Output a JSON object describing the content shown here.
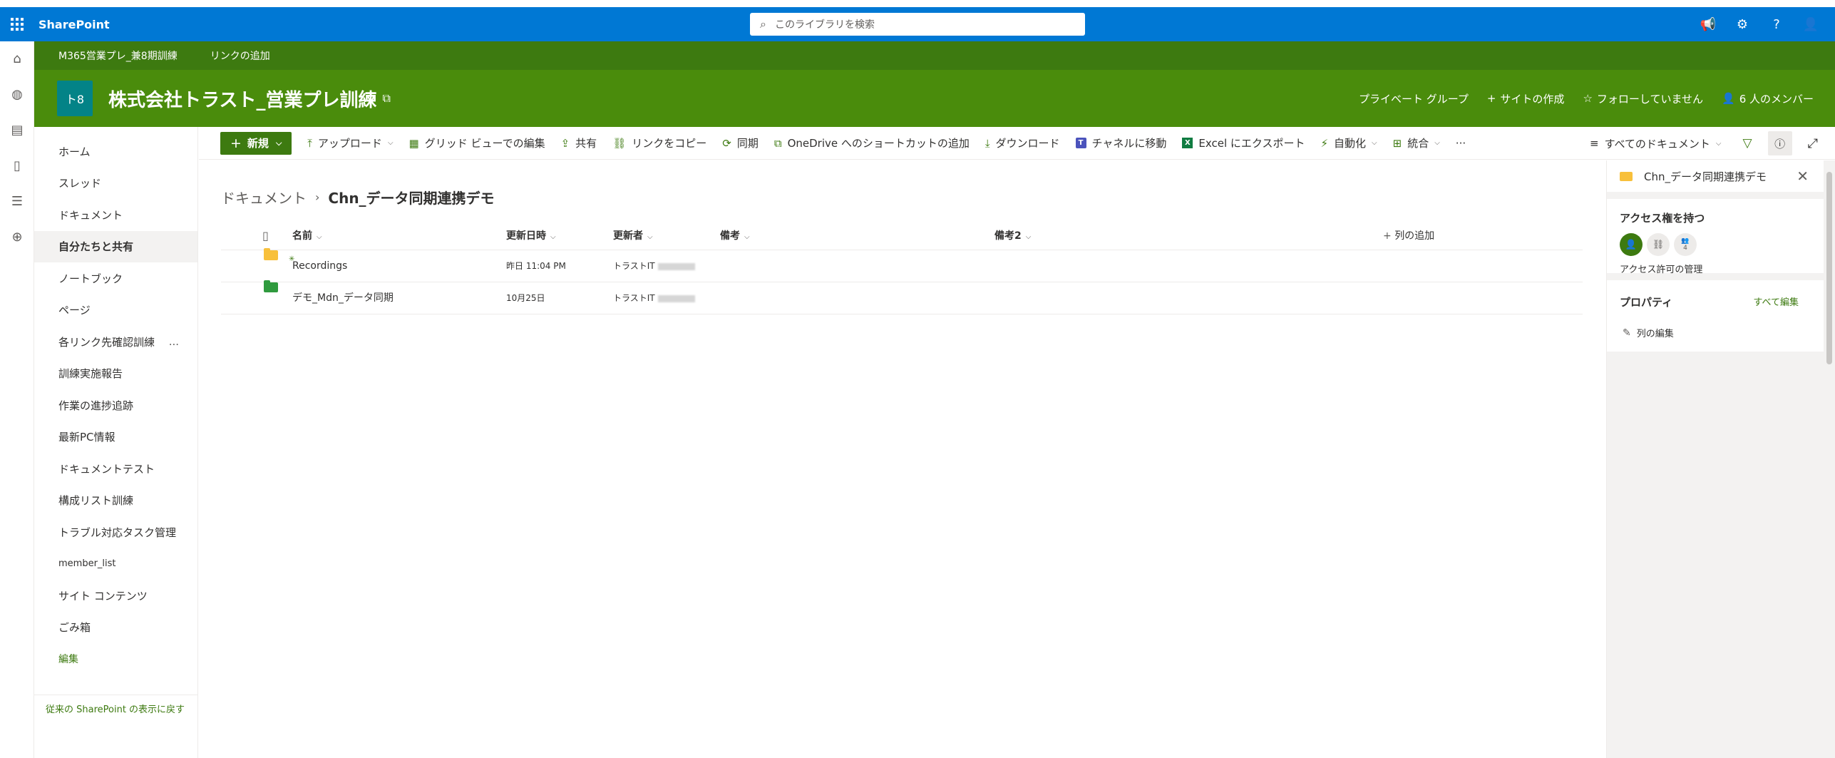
{
  "app": {
    "name": "SharePoint"
  },
  "search": {
    "placeholder": "このライブラリを検索"
  },
  "hub_nav": {
    "items": [
      "M365営業プレ_兼8期訓練",
      "リンクの追加"
    ]
  },
  "site": {
    "logo_text": "ト8",
    "title": "株式会社トラスト_営業プレ訓練",
    "privacy": "プライベート グループ",
    "create_site": "サイトの作成",
    "follow": "フォローしていません",
    "members": "6 人のメンバー"
  },
  "left_nav": {
    "items": [
      "ホーム",
      "スレッド",
      "ドキュメント",
      "自分たちと共有",
      "ノートブック",
      "ページ",
      "各リンク先確認訓練",
      "訓練実施報告",
      "作業の進捗追跡",
      "最新PC情報",
      "ドキュメントテスト",
      "構成リスト訓練",
      "トラブル対応タスク管理",
      "member_list",
      "サイト コンテンツ",
      "ごみ箱"
    ],
    "active_index": 3,
    "more_glyph": "...",
    "edit": "編集",
    "classic_link": "従来の SharePoint の表示に戻す"
  },
  "command_bar": {
    "new": "新規",
    "upload": "アップロード",
    "grid_edit": "グリッド ビューでの編集",
    "share": "共有",
    "copy_link": "リンクをコピー",
    "sync": "同期",
    "onedrive_shortcut": "OneDrive へのショートカットの追加",
    "download": "ダウンロード",
    "move_to_channel": "チャネルに移動",
    "export_excel": "Excel にエクスポート",
    "automate": "自動化",
    "integrate": "統合",
    "more": "···",
    "view": "すべてのドキュメント"
  },
  "breadcrumb": {
    "root": "ドキュメント",
    "current": "Chn_データ同期連携デモ"
  },
  "columns": {
    "name": "名前",
    "modified": "更新日時",
    "modified_by": "更新者",
    "note": "備考",
    "note2": "備考2",
    "add_column": "列の追加"
  },
  "rows": [
    {
      "name": "Recordings",
      "modified": "昨日 11:04 PM",
      "modified_by": "トラストIT",
      "folder_color": "#f8c03b"
    },
    {
      "name": "デモ_Mdn_データ同期",
      "modified": "10月25日",
      "modified_by": "トラストIT",
      "folder_color": "#2f9a3e"
    }
  ],
  "details_pane": {
    "title": "Chn_データ同期連携デモ",
    "access_heading": "アクセス権を持つ",
    "avatar_count": "4",
    "manage_access": "アクセス許可の管理",
    "properties_heading": "プロパティ",
    "edit_all": "すべて編集",
    "edit_columns": "列の編集"
  },
  "colors": {
    "suite_blue": "#0078d4",
    "site_green": "#4a8c0c",
    "hub_green": "#3d7a10",
    "accent": "#3d7a10"
  }
}
